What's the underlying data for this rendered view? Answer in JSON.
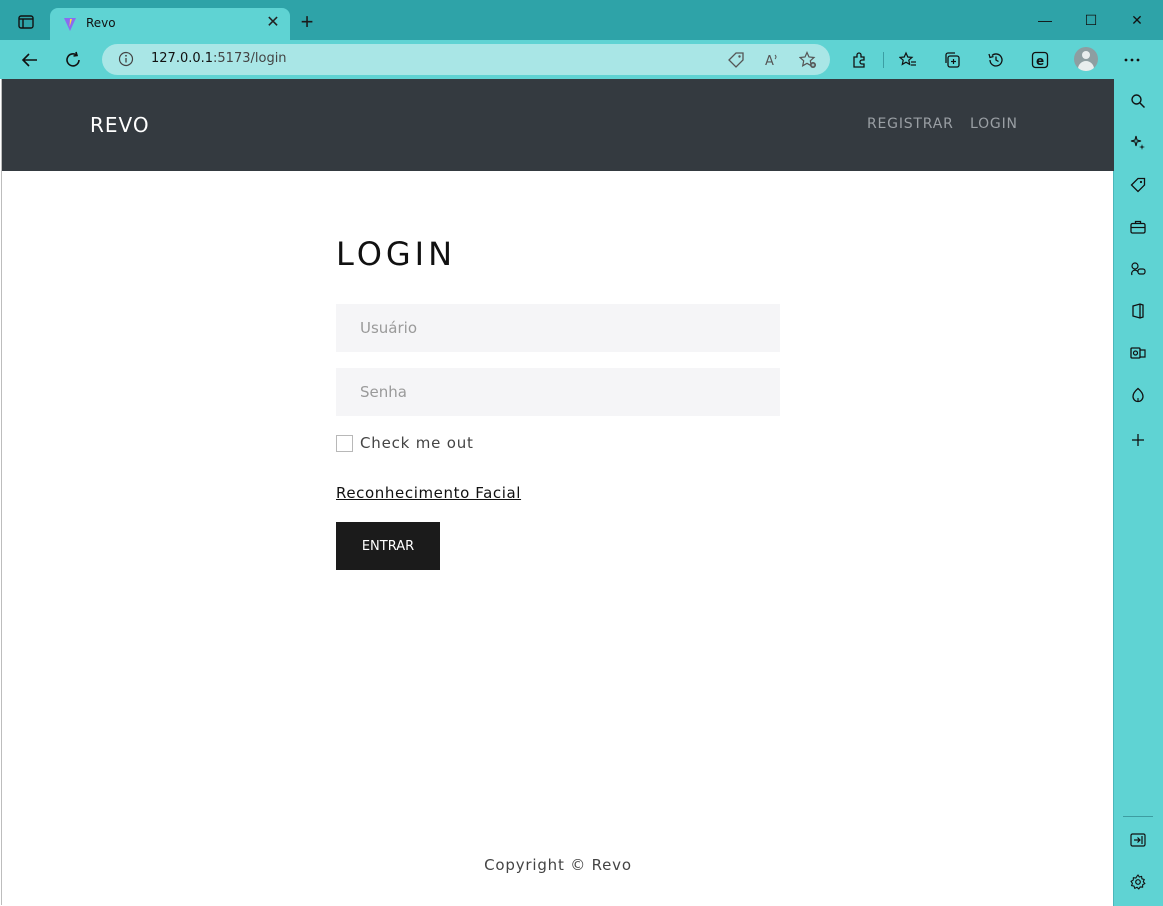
{
  "browser": {
    "tab_title": "Revo",
    "address": {
      "host": "127.0.0.1",
      "rest": ":5173/login"
    }
  },
  "site": {
    "brand": "REVO",
    "nav": [
      {
        "label": "REGISTRAR"
      },
      {
        "label": "LOGIN"
      }
    ]
  },
  "login": {
    "title": "LOGIN",
    "username_placeholder": "Usuário",
    "password_placeholder": "Senha",
    "checkbox_label": "Check me out",
    "facial_link": "Reconhecimento Facial",
    "submit_label": "ENTRAR"
  },
  "footer": {
    "text": "Copyright © Revo"
  },
  "colors": {
    "chrome_dark": "#2ea3a8",
    "chrome_light": "#5fd3d3",
    "navbar": "#343a40",
    "button": "#1b1b1b",
    "input_bg": "#f5f5f7"
  }
}
